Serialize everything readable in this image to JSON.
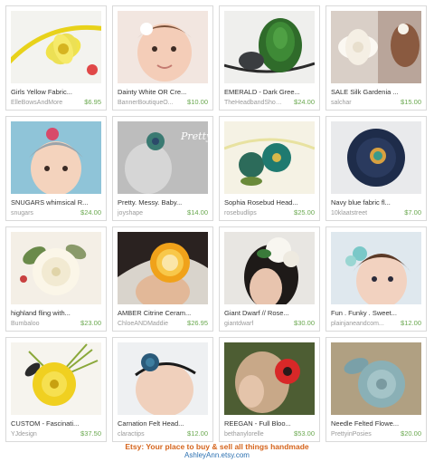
{
  "listings": [
    {
      "title": "Girls Yellow Fabric...",
      "shop": "ElleBowsAndMore",
      "price": "$6.95"
    },
    {
      "title": "Dainty White OR Cre...",
      "shop": "BannerBoutiqueO...",
      "price": "$10.00"
    },
    {
      "title": "EMERALD - Dark Gree...",
      "shop": "TheHeadbandShop...",
      "price": "$24.00"
    },
    {
      "title": "SALE Silk Gardenia ...",
      "shop": "salchar",
      "price": "$15.00"
    },
    {
      "title": "SNUGARS whimsical R...",
      "shop": "snugars",
      "price": "$24.00"
    },
    {
      "title": "Pretty. Messy. Baby...",
      "shop": "joyshape",
      "price": "$14.00",
      "image_text": "Pretty Messy Baby"
    },
    {
      "title": "Sophia Rosebud Head...",
      "shop": "rosebudlips",
      "price": "$25.00"
    },
    {
      "title": "Navy blue fabric fl...",
      "shop": "10klaatstreet",
      "price": "$7.00"
    },
    {
      "title": "highland fling with...",
      "shop": "Bumbaloo",
      "price": "$23.00"
    },
    {
      "title": "AMBER Citrine Ceram...",
      "shop": "ChloeANDMaddie",
      "price": "$26.95"
    },
    {
      "title": "Giant Dwarf // Rose...",
      "shop": "giantdwarf",
      "price": "$30.00"
    },
    {
      "title": "Fun . Funky . Sweet...",
      "shop": "plainjaneandcom...",
      "price": "$12.00"
    },
    {
      "title": "CUSTOM - Fascinati...",
      "shop": "YJdesign",
      "price": "$37.50"
    },
    {
      "title": "Carnation Felt Head...",
      "shop": "claractips",
      "price": "$12.00"
    },
    {
      "title": "REEGAN - Full Bloo...",
      "shop": "bethanylorelle",
      "price": "$53.00"
    },
    {
      "title": "Needle Felted Flowe...",
      "shop": "PrettyinPosies",
      "price": "$20.00"
    }
  ],
  "footer": {
    "tagline": "Etsy: Your place to buy & sell all things handmade",
    "site": "AshleyAnn.etsy.com"
  },
  "colors": {
    "price": "#6aa84f",
    "shop": "#9a9a9a",
    "tagline": "#d5641c",
    "site": "#2a6fb0"
  }
}
